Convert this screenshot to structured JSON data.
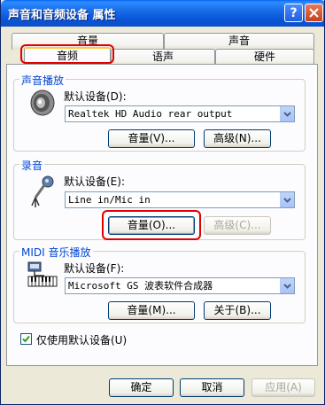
{
  "window": {
    "title": "声音和音频设备 属性",
    "help_label": "?",
    "close_label": "✕"
  },
  "tabs": {
    "row_top": [
      "音量",
      "声音"
    ],
    "row_bottom": [
      "音频",
      "语声",
      "硬件"
    ],
    "active": "音频"
  },
  "playback": {
    "group_title": "声音播放",
    "default_label": "默认设备(D):",
    "device_value": "Realtek HD Audio rear output",
    "volume_button": "音量(V)...",
    "advanced_button": "高级(N)...",
    "icon": "speaker-icon"
  },
  "recording": {
    "group_title": "录音",
    "default_label": "默认设备(E):",
    "device_value": "Line in/Mic in",
    "volume_button": "音量(O)...",
    "advanced_button": "高级(C)...",
    "icon": "microphone-icon"
  },
  "midi": {
    "group_title": "MIDI 音乐播放",
    "default_label": "默认设备(F):",
    "device_value": "Microsoft GS 波表软件合成器",
    "volume_button": "音量(M)...",
    "about_button": "关于(B)...",
    "icon": "midi-keyboard-icon"
  },
  "use_default_only": {
    "label": "仅使用默认设备(U)",
    "checked": true
  },
  "footer": {
    "ok": "确定",
    "cancel": "取消",
    "apply": "应用(A)"
  },
  "colors": {
    "titlebar": "#0A57D8",
    "highlight": "#E00000",
    "group_title": "#0046D5",
    "dialog_bg": "#ECE9D8"
  }
}
